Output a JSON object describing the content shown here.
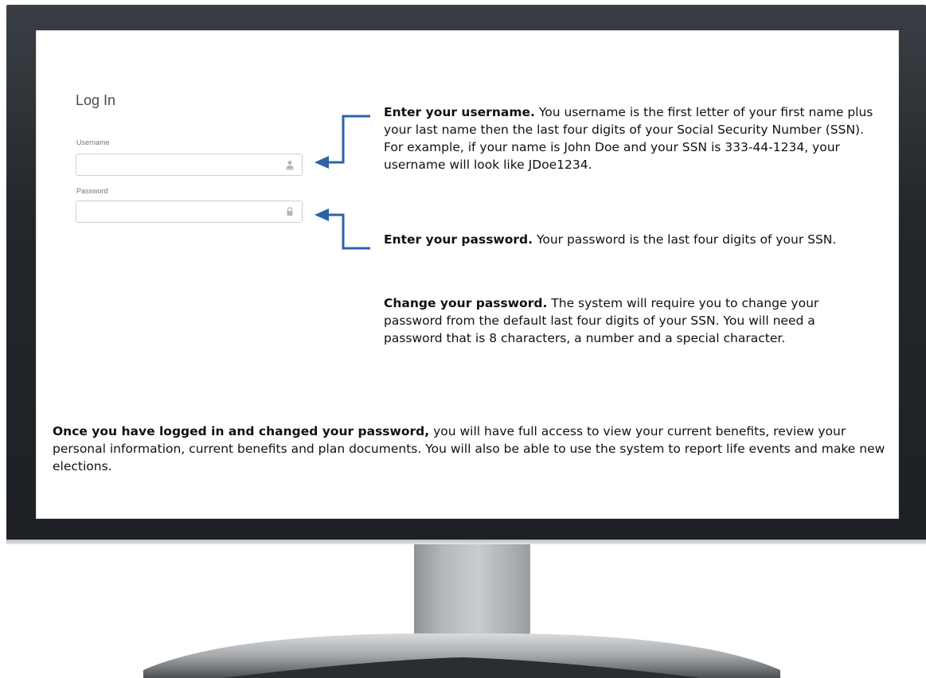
{
  "login": {
    "title": "Log In",
    "username_label": "Username",
    "username_value": "",
    "username_icon": "user-icon",
    "password_label": "Password",
    "password_value": "",
    "password_icon": "lock-icon"
  },
  "instructions": {
    "username": {
      "heading": "Enter your username.",
      "body": "You username is the first letter of your first name plus your last name then the last four digits of your Social Security Number (SSN). For example, if your name is John Doe and your SSN is 333-44-1234, your username will look like JDoe1234."
    },
    "password": {
      "heading": "Enter your password.",
      "body": "Your password is the last four digits of your SSN."
    },
    "change_password": {
      "heading": "Change your password.",
      "body": "The system will require you to change your password from the default last four digits of your SSN. You will need a password that is 8 characters, a number and a special character."
    }
  },
  "footer": {
    "heading": "Once you have logged in and changed your password,",
    "body": "you will have full access to view your current benefits, review your personal information, current benefits and plan documents. You will also be able to use the system to report life events and make new elections."
  },
  "colors": {
    "arrow": "#2e62a8",
    "bezel": "#23272b",
    "text": "#111111"
  }
}
